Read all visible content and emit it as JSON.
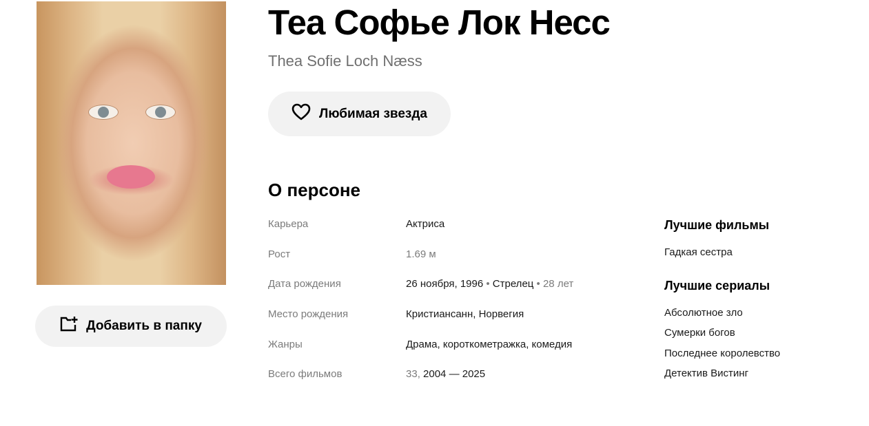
{
  "person": {
    "name_ru": "Теа Софье Лок Несс",
    "name_original": "Thea Sofie Loch Næss"
  },
  "actions": {
    "favorite_label": "Любимая звезда",
    "favorite_icon": "heart-icon",
    "add_folder_label": "Добавить в папку",
    "add_folder_icon": "folder-plus-icon"
  },
  "about": {
    "title": "О персоне",
    "career": {
      "label": "Карьера",
      "value": "Актриса"
    },
    "height": {
      "label": "Рост",
      "value": "1.69 м"
    },
    "birth_date": {
      "label": "Дата рождения",
      "date": "26 ноября, 1996",
      "sep1": " • ",
      "zodiac": "Стрелец",
      "sep2": " • ",
      "age": "28 лет"
    },
    "birth_place": {
      "label": "Место рождения",
      "city": "Кристиансанн",
      "sep": ", ",
      "country": "Норвегия"
    },
    "genres": {
      "label": "Жанры",
      "g1": "Драма",
      "g2": "короткометражка",
      "g3": "комедия",
      "sep": ", "
    },
    "total_films": {
      "label": "Всего фильмов",
      "count": "33",
      "sep": ", ",
      "years": "2004 — 2025"
    }
  },
  "best_films": {
    "title": "Лучшие фильмы",
    "items": [
      "Гадкая сестра"
    ]
  },
  "best_series": {
    "title": "Лучшие сериалы",
    "items": [
      "Абсолютное зло",
      "Сумерки богов",
      "Последнее королевство",
      "Детектив Вистинг"
    ]
  }
}
